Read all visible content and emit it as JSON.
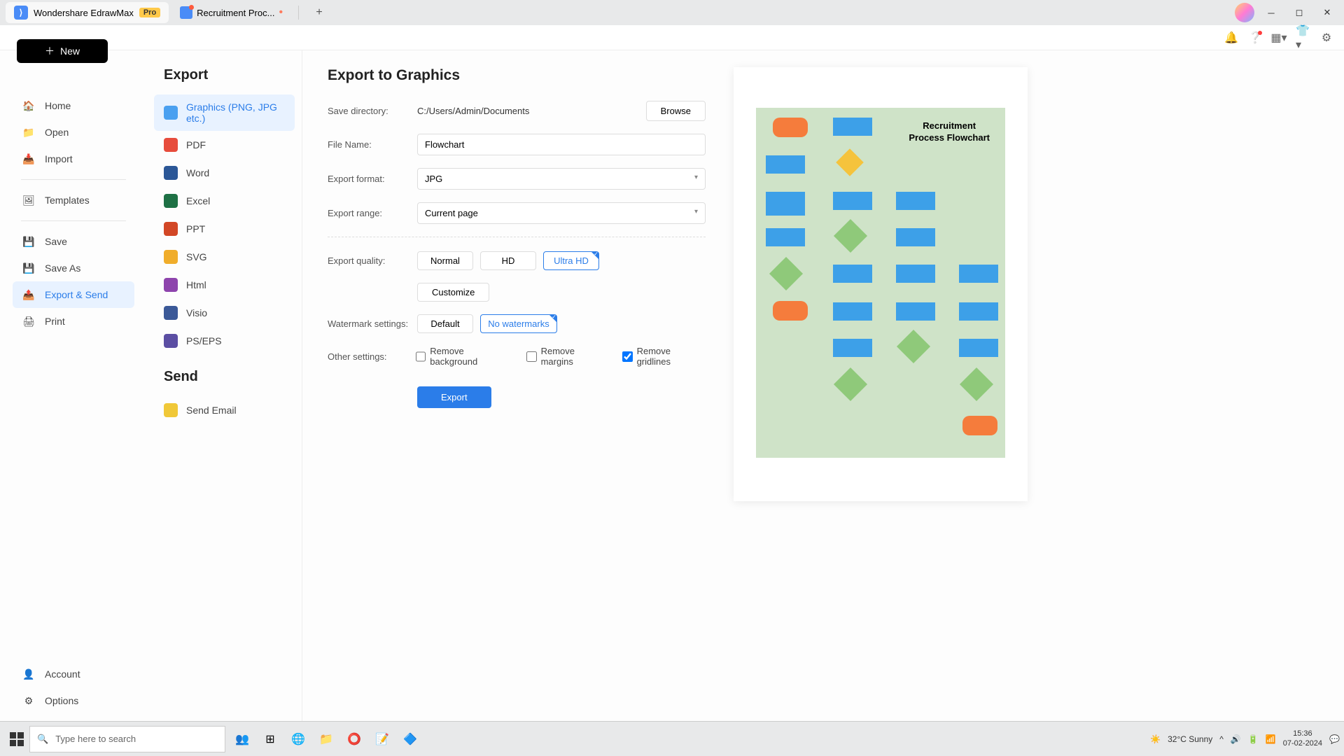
{
  "titlebar": {
    "app_name": "Wondershare EdrawMax",
    "pro": "Pro",
    "doc_tab": "Recruitment Proc...",
    "win": {
      "min": "─",
      "max": "◻",
      "close": "✕"
    }
  },
  "topbar": {
    "new_label": "New"
  },
  "nav": {
    "home": "Home",
    "open": "Open",
    "import": "Import",
    "templates": "Templates",
    "save": "Save",
    "saveas": "Save As",
    "export": "Export & Send",
    "print": "Print",
    "account": "Account",
    "options": "Options"
  },
  "export": {
    "title": "Export",
    "items": {
      "graphics": "Graphics (PNG, JPG etc.)",
      "pdf": "PDF",
      "word": "Word",
      "excel": "Excel",
      "ppt": "PPT",
      "svg": "SVG",
      "html": "Html",
      "visio": "Visio",
      "pseps": "PS/EPS"
    },
    "send_title": "Send",
    "send_email": "Send Email"
  },
  "form": {
    "title": "Export to Graphics",
    "save_dir_label": "Save directory:",
    "save_dir": "C:/Users/Admin/Documents",
    "browse": "Browse",
    "filename_label": "File Name:",
    "filename": "Flowchart",
    "format_label": "Export format:",
    "format": "JPG",
    "range_label": "Export range:",
    "range": "Current page",
    "quality_label": "Export quality:",
    "q_normal": "Normal",
    "q_hd": "HD",
    "q_uhd": "Ultra HD",
    "customize": "Customize",
    "watermark_label": "Watermark settings:",
    "wm_default": "Default",
    "wm_none": "No watermarks",
    "other_label": "Other settings:",
    "rm_bg": "Remove background",
    "rm_margin": "Remove margins",
    "rm_grid": "Remove gridlines",
    "export_btn": "Export"
  },
  "preview": {
    "title_l1": "Recruitment",
    "title_l2": "Process Flowchart"
  },
  "taskbar": {
    "search_placeholder": "Type here to search",
    "weather": "32°C  Sunny",
    "time": "15:36",
    "date": "07-02-2024"
  }
}
